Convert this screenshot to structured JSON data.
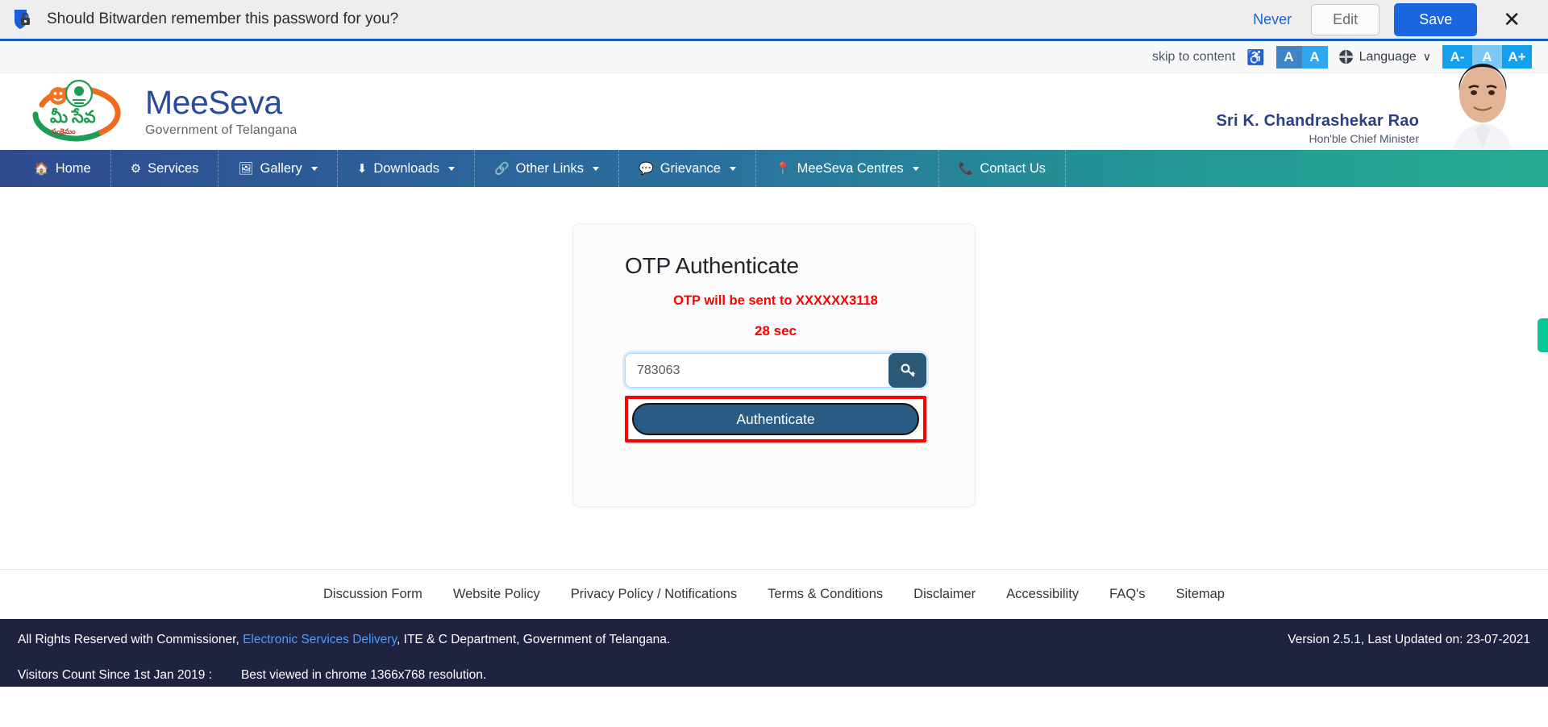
{
  "password_prompt": {
    "icon": "bitwarden-shield-lock-icon",
    "message": "Should Bitwarden remember this password for you?",
    "never_label": "Never",
    "edit_label": "Edit",
    "save_label": "Save",
    "close_label": "✕",
    "accent_color": "#1a66e0",
    "border_color": "#1559c7"
  },
  "accessibility_bar": {
    "skip_label": "skip to content",
    "wheelchair_icon": "wheelchair-accessibility-icon",
    "contrast": [
      {
        "label": "A",
        "name": "contrast-dark",
        "color": "#3f84c4"
      },
      {
        "label": "A",
        "name": "contrast-light",
        "color": "#2fa8ef"
      }
    ],
    "language_label": "Language",
    "language_icon": "globe-icon",
    "chevron": "∨",
    "font_sizes": [
      {
        "label": "A-",
        "name": "font-decrease",
        "color": "#14a0ec"
      },
      {
        "label": "A",
        "name": "font-normal",
        "color": "#7dc8f5"
      },
      {
        "label": "A+",
        "name": "font-increase",
        "color": "#14a0ec"
      }
    ]
  },
  "masthead": {
    "brand_title": "MeeSeva",
    "brand_sub": "Government of Telangana",
    "logo_alt": "meeseva-emblem-logo",
    "cm_name": "Sri K. Chandrashekar Rao",
    "cm_role": "Hon'ble Chief Minister",
    "cm_photo_alt": "chief-minister-portrait"
  },
  "nav": {
    "items": [
      {
        "label": "Home",
        "icon": "home-icon",
        "glyph": "⌂",
        "caret": false
      },
      {
        "label": "Services",
        "icon": "gear-icon",
        "glyph": "⚙",
        "caret": false
      },
      {
        "label": "Gallery",
        "icon": "image-icon",
        "glyph": "Ὓb",
        "caret": true
      },
      {
        "label": "Downloads",
        "icon": "download-icon",
        "glyph": "⬇",
        "caret": true
      },
      {
        "label": "Other Links",
        "icon": "link-icon",
        "glyph": "%",
        "caret": true
      },
      {
        "label": "Grievance",
        "icon": "comment-icon",
        "glyph": "Ὂc",
        "caret": true
      },
      {
        "label": "MeeSeva Centres",
        "icon": "map-pin-icon",
        "glyph": "Ὄd",
        "caret": true
      },
      {
        "label": "Contact Us",
        "icon": "phone-icon",
        "glyph": "Ὅe",
        "caret": false
      }
    ]
  },
  "otp_card": {
    "title": "OTP Authenticate",
    "message": "OTP will be sent to XXXXXX3118",
    "timer": "28 sec",
    "otp_value": "783063",
    "otp_placeholder": "",
    "key_button_icon": "key-icon",
    "authenticate_label": "Authenticate",
    "message_color": "#ff0000",
    "button_color": "#2a5b82",
    "highlight_color": "#ff0000"
  },
  "side_tab": {
    "name": "feedback-side-tab",
    "color": "#05c89a"
  },
  "footer_links": [
    "Discussion Form",
    "Website Policy",
    "Privacy Policy / Notifications",
    "Terms & Conditions",
    "Disclaimer",
    "Accessibility",
    "FAQ's",
    "Sitemap"
  ],
  "footer": {
    "copyright_pre": "All Rights Reserved with Commissioner, ",
    "copyright_link": "Electronic Services Delivery",
    "copyright_post": ", ITE & C Department, Government of Telangana.",
    "version": "Version 2.5.1, Last Updated on: 23-07-2021",
    "visitors_label": "Visitors Count Since 1st Jan 2019 :",
    "best_viewed": "Best viewed in chrome 1366x768 resolution.",
    "link_color": "#4a9eff",
    "background": "#1f2340"
  }
}
